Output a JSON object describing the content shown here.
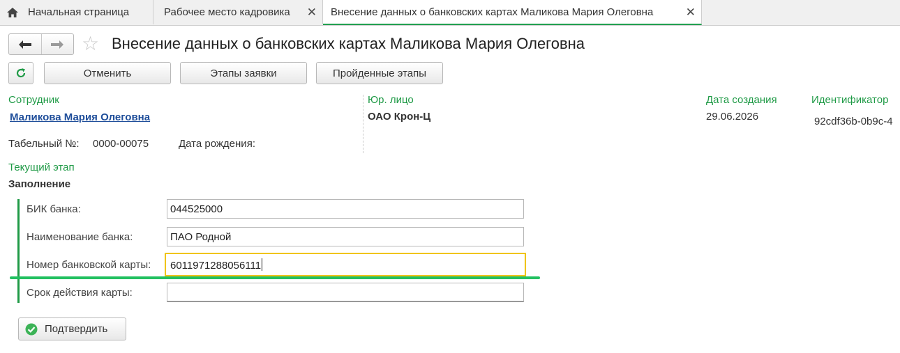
{
  "tabs": [
    {
      "label": "Начальная страница"
    },
    {
      "label": "Рабочее место кадровика"
    },
    {
      "label": "Внесение данных о банковских картах Маликова Мария Олеговна"
    }
  ],
  "header": {
    "title": "Внесение данных о банковских картах Маликова Мария Олеговна"
  },
  "toolbar": {
    "cancel_label": "Отменить",
    "stages_label": "Этапы заявки",
    "passed_label": "Пройденные этапы"
  },
  "info": {
    "employee_label": "Сотрудник",
    "employee_name": "Маликова Мария Олеговна",
    "tab_number_label": "Табельный №:",
    "tab_number": "0000-00075",
    "birth_date_label": "Дата рождения:",
    "legal_entity_label": "Юр. лицо",
    "legal_entity": "ОАО Крон-Ц",
    "created_label": "Дата создания",
    "created_date": "29.06.2026",
    "id_label": "Идентификатор",
    "id_value": "92cdf36b-0b9c-4"
  },
  "stage": {
    "label": "Текущий этап",
    "value": "Заполнение"
  },
  "form": {
    "bik_label": "БИК банка:",
    "bik_value": "044525000",
    "bank_name_label": "Наименование банка:",
    "bank_name_value": "ПАО Родной",
    "card_number_label": "Номер банковской карты:",
    "card_number_value": "6011971288056111",
    "expiry_label": "Срок действия карты:",
    "expiry_value": ""
  },
  "confirm_label": "Подтвердить",
  "colors": {
    "accent_green": "#1f9a46",
    "link_blue": "#1f4e9a",
    "focus_yellow": "#f0c419"
  }
}
